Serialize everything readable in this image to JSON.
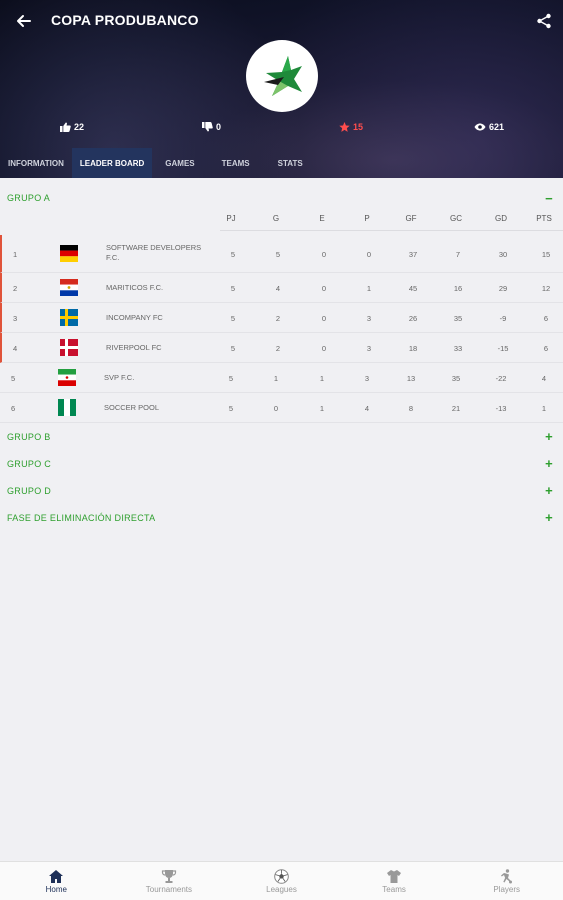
{
  "header": {
    "title": "COPA PRODUBANCO",
    "likes": "22",
    "dislikes": "0",
    "stars": "15",
    "views": "621"
  },
  "tabs": [
    {
      "label": "INFORMATION"
    },
    {
      "label": "LEADER BOARD"
    },
    {
      "label": "GAMES"
    },
    {
      "label": "TEAMS"
    },
    {
      "label": "STATS"
    }
  ],
  "groups": [
    {
      "label": "GRUPO A",
      "toggle": "−"
    },
    {
      "label": "GRUPO B",
      "toggle": "+"
    },
    {
      "label": "GRUPO C",
      "toggle": "+"
    },
    {
      "label": "GRUPO D",
      "toggle": "+"
    },
    {
      "label": "FASE DE ELIMINACIÓN DIRECTA",
      "toggle": "+"
    }
  ],
  "table": {
    "columns": [
      "PJ",
      "G",
      "E",
      "P",
      "GF",
      "GC",
      "GD",
      "PTS"
    ],
    "rows": [
      {
        "pos": "1",
        "team": "SOFTWARE DEVELOPERS F.C.",
        "flag": "germany",
        "values": [
          "5",
          "5",
          "0",
          "0",
          "37",
          "7",
          "30",
          "15"
        ]
      },
      {
        "pos": "2",
        "team": "MARITICOS F.C.",
        "flag": "paraguay",
        "values": [
          "5",
          "4",
          "0",
          "1",
          "45",
          "16",
          "29",
          "12"
        ]
      },
      {
        "pos": "3",
        "team": "INCOMPANY FC",
        "flag": "sweden",
        "values": [
          "5",
          "2",
          "0",
          "3",
          "26",
          "35",
          "-9",
          "6"
        ]
      },
      {
        "pos": "4",
        "team": "RIVERPOOL FC",
        "flag": "denmark",
        "values": [
          "5",
          "2",
          "0",
          "3",
          "18",
          "33",
          "-15",
          "6"
        ]
      },
      {
        "pos": "5",
        "team": "SVP F.C.",
        "flag": "iran",
        "values": [
          "5",
          "1",
          "1",
          "3",
          "13",
          "35",
          "-22",
          "4"
        ]
      },
      {
        "pos": "6",
        "team": "SOCCER POOL",
        "flag": "nigeria",
        "values": [
          "5",
          "0",
          "1",
          "4",
          "8",
          "21",
          "-13",
          "1"
        ]
      }
    ]
  },
  "bottom_nav": [
    {
      "label": "Home"
    },
    {
      "label": "Tournaments"
    },
    {
      "label": "Leagues"
    },
    {
      "label": "Teams"
    },
    {
      "label": "Players"
    }
  ],
  "colors": {
    "accent_green": "#2e9f2e",
    "qualified_marker": "#e0533a",
    "active_tab": "#23345e"
  }
}
